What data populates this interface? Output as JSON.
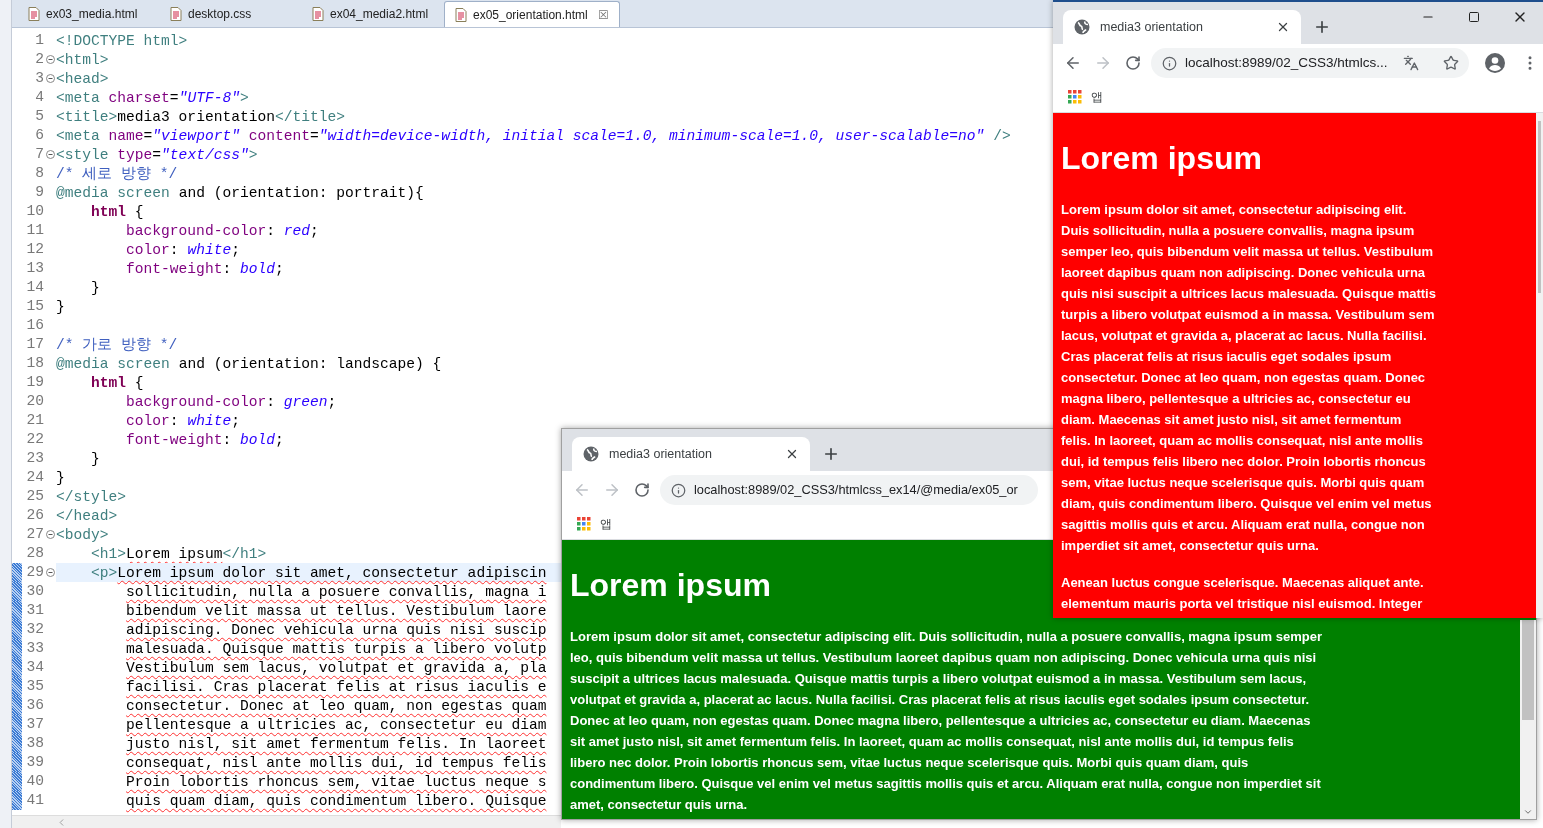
{
  "editor": {
    "tabs": [
      {
        "label": "ex03_media.html",
        "selected": false
      },
      {
        "label": "desktop.css",
        "selected": false
      },
      {
        "label": "ex04_media2.html",
        "selected": false
      },
      {
        "label": "ex05_orientation.html",
        "selected": true,
        "close": "☒"
      }
    ],
    "lines": [
      {
        "number": "1",
        "fold": false,
        "changed": false,
        "current": false,
        "tokens": [
          {
            "kind": "tag",
            "text": "<!DOCTYPE html>"
          }
        ]
      },
      {
        "number": "2",
        "fold": true,
        "changed": false,
        "current": false,
        "tokens": [
          {
            "kind": "tag",
            "text": "<html>"
          }
        ]
      },
      {
        "number": "3",
        "fold": true,
        "changed": false,
        "current": false,
        "tokens": [
          {
            "kind": "tag",
            "text": "<head>"
          }
        ]
      },
      {
        "number": "4",
        "fold": false,
        "changed": false,
        "current": false,
        "tokens": [
          {
            "kind": "tag",
            "text": "<meta "
          },
          {
            "kind": "attr",
            "text": "charset"
          },
          {
            "kind": "text",
            "text": "="
          },
          {
            "kind": "value",
            "text": "\"UTF-8\""
          },
          {
            "kind": "tag",
            "text": ">"
          }
        ]
      },
      {
        "number": "5",
        "fold": false,
        "changed": false,
        "current": false,
        "tokens": [
          {
            "kind": "tag",
            "text": "<title>"
          },
          {
            "kind": "text",
            "text": "media3 orientation"
          },
          {
            "kind": "tag",
            "text": "</title>"
          }
        ]
      },
      {
        "number": "6",
        "fold": false,
        "changed": false,
        "current": false,
        "tokens": [
          {
            "kind": "tag",
            "text": "<meta "
          },
          {
            "kind": "attr",
            "text": "name"
          },
          {
            "kind": "text",
            "text": "="
          },
          {
            "kind": "value",
            "text": "\"viewport\""
          },
          {
            "kind": "attr",
            "text": " content"
          },
          {
            "kind": "text",
            "text": "="
          },
          {
            "kind": "value",
            "text": "\"width=device-width, initial scale=1.0, minimum-scale=1.0, user-scalable=no\""
          },
          {
            "kind": "tag",
            "text": " />"
          }
        ]
      },
      {
        "number": "7",
        "fold": true,
        "changed": false,
        "current": false,
        "tokens": [
          {
            "kind": "tag",
            "text": "<style "
          },
          {
            "kind": "attr",
            "text": "type"
          },
          {
            "kind": "text",
            "text": "="
          },
          {
            "kind": "value",
            "text": "\"text/css\""
          },
          {
            "kind": "tag",
            "text": ">"
          }
        ]
      },
      {
        "number": "8",
        "fold": false,
        "changed": false,
        "current": false,
        "tokens": [
          {
            "kind": "comment",
            "text": "/* 세로 방향 */"
          }
        ]
      },
      {
        "number": "9",
        "fold": false,
        "changed": false,
        "current": false,
        "tokens": [
          {
            "kind": "atrule",
            "text": "@media"
          },
          {
            "kind": "atrule",
            "text": " screen"
          },
          {
            "kind": "text",
            "text": " and (orientation: portrait){"
          }
        ]
      },
      {
        "number": "10",
        "fold": false,
        "changed": false,
        "current": false,
        "tokens": [
          {
            "kind": "selector",
            "text": "    html"
          },
          {
            "kind": "text",
            "text": " {"
          }
        ]
      },
      {
        "number": "11",
        "fold": false,
        "changed": false,
        "current": false,
        "tokens": [
          {
            "kind": "property",
            "text": "        background-color"
          },
          {
            "kind": "text",
            "text": ": "
          },
          {
            "kind": "value",
            "text": "red"
          },
          {
            "kind": "text",
            "text": ";"
          }
        ]
      },
      {
        "number": "12",
        "fold": false,
        "changed": false,
        "current": false,
        "tokens": [
          {
            "kind": "property",
            "text": "        color"
          },
          {
            "kind": "text",
            "text": ": "
          },
          {
            "kind": "value",
            "text": "white"
          },
          {
            "kind": "text",
            "text": ";"
          }
        ]
      },
      {
        "number": "13",
        "fold": false,
        "changed": false,
        "current": false,
        "tokens": [
          {
            "kind": "property",
            "text": "        font-weight"
          },
          {
            "kind": "text",
            "text": ": "
          },
          {
            "kind": "value",
            "text": "bold"
          },
          {
            "kind": "text",
            "text": ";"
          }
        ]
      },
      {
        "number": "14",
        "fold": false,
        "changed": false,
        "current": false,
        "tokens": [
          {
            "kind": "text",
            "text": "    }"
          }
        ]
      },
      {
        "number": "15",
        "fold": false,
        "changed": false,
        "current": false,
        "tokens": [
          {
            "kind": "text",
            "text": "}"
          }
        ]
      },
      {
        "number": "16",
        "fold": false,
        "changed": false,
        "current": false
      },
      {
        "number": "17",
        "fold": false,
        "changed": false,
        "current": false,
        "tokens": [
          {
            "kind": "comment",
            "text": "/* 가로 방향 */"
          }
        ]
      },
      {
        "number": "18",
        "fold": false,
        "changed": false,
        "current": false,
        "tokens": [
          {
            "kind": "atrule",
            "text": "@media"
          },
          {
            "kind": "atrule",
            "text": " screen"
          },
          {
            "kind": "text",
            "text": " and (orientation: landscape) {"
          }
        ]
      },
      {
        "number": "19",
        "fold": false,
        "changed": false,
        "current": false,
        "tokens": [
          {
            "kind": "selector",
            "text": "    html"
          },
          {
            "kind": "text",
            "text": " {"
          }
        ]
      },
      {
        "number": "20",
        "fold": false,
        "changed": false,
        "current": false,
        "tokens": [
          {
            "kind": "property",
            "text": "        background-color"
          },
          {
            "kind": "text",
            "text": ": "
          },
          {
            "kind": "value",
            "text": "green"
          },
          {
            "kind": "text",
            "text": ";"
          }
        ]
      },
      {
        "number": "21",
        "fold": false,
        "changed": false,
        "current": false,
        "tokens": [
          {
            "kind": "property",
            "text": "        color"
          },
          {
            "kind": "text",
            "text": ": "
          },
          {
            "kind": "value",
            "text": "white"
          },
          {
            "kind": "text",
            "text": ";"
          }
        ]
      },
      {
        "number": "22",
        "fold": false,
        "changed": false,
        "current": false,
        "tokens": [
          {
            "kind": "property",
            "text": "        font-weight"
          },
          {
            "kind": "text",
            "text": ": "
          },
          {
            "kind": "value",
            "text": "bold"
          },
          {
            "kind": "text",
            "text": ";"
          }
        ]
      },
      {
        "number": "23",
        "fold": false,
        "changed": false,
        "current": false,
        "tokens": [
          {
            "kind": "text",
            "text": "    }"
          }
        ]
      },
      {
        "number": "24",
        "fold": false,
        "changed": false,
        "current": false,
        "tokens": [
          {
            "kind": "text",
            "text": "}"
          }
        ]
      },
      {
        "number": "25",
        "fold": false,
        "changed": false,
        "current": false,
        "tokens": [
          {
            "kind": "tag",
            "text": "</style>"
          }
        ]
      },
      {
        "number": "26",
        "fold": false,
        "changed": false,
        "current": false,
        "tokens": [
          {
            "kind": "tag",
            "text": "</head>"
          }
        ]
      },
      {
        "number": "27",
        "fold": true,
        "changed": false,
        "current": false,
        "tokens": [
          {
            "kind": "tag",
            "text": "<body>"
          }
        ]
      },
      {
        "number": "28",
        "fold": false,
        "changed": false,
        "current": false,
        "tokens": [
          {
            "kind": "tag",
            "text": "    <h1>"
          },
          {
            "kind": "spell",
            "text": "Lorem ipsum"
          },
          {
            "kind": "tag",
            "text": "</h1>"
          }
        ]
      },
      {
        "number": "29",
        "fold": true,
        "changed": true,
        "current": true,
        "tokens": [
          {
            "kind": "tag",
            "text": "    <p>"
          },
          {
            "kind": "spell",
            "text": "Lorem ipsum dolor sit amet, consectetur adipiscin"
          }
        ]
      },
      {
        "number": "30",
        "fold": false,
        "changed": true,
        "current": false,
        "tokens": [
          {
            "kind": "spell",
            "text": "        sollicitudin, nulla a posuere convallis, magna i"
          }
        ]
      },
      {
        "number": "31",
        "fold": false,
        "changed": true,
        "current": false,
        "tokens": [
          {
            "kind": "spell",
            "text": "        bibendum velit massa ut tellus. Vestibulum laore"
          }
        ]
      },
      {
        "number": "32",
        "fold": false,
        "changed": true,
        "current": false,
        "tokens": [
          {
            "kind": "spell",
            "text": "        adipiscing. Donec vehicula urna quis nisi suscip"
          }
        ]
      },
      {
        "number": "33",
        "fold": false,
        "changed": true,
        "current": false,
        "tokens": [
          {
            "kind": "spell",
            "text": "        malesuada. Quisque mattis turpis a libero volutp"
          }
        ]
      },
      {
        "number": "34",
        "fold": false,
        "changed": true,
        "current": false,
        "tokens": [
          {
            "kind": "spell",
            "text": "        Vestibulum sem lacus, volutpat et gravida a, pla"
          }
        ]
      },
      {
        "number": "35",
        "fold": false,
        "changed": true,
        "current": false,
        "tokens": [
          {
            "kind": "spell",
            "text": "        facilisi. Cras placerat felis at risus iaculis e"
          }
        ]
      },
      {
        "number": "36",
        "fold": false,
        "changed": true,
        "current": false,
        "tokens": [
          {
            "kind": "spell",
            "text": "        consectetur. Donec at leo quam, non egestas quam"
          }
        ]
      },
      {
        "number": "37",
        "fold": false,
        "changed": true,
        "current": false,
        "tokens": [
          {
            "kind": "spell",
            "text": "        pellentesque a ultricies ac, consectetur eu diam"
          }
        ]
      },
      {
        "number": "38",
        "fold": false,
        "changed": true,
        "current": false,
        "tokens": [
          {
            "kind": "spell",
            "text": "        justo nisl, sit amet fermentum felis. In laoreet"
          }
        ]
      },
      {
        "number": "39",
        "fold": false,
        "changed": true,
        "current": false,
        "tokens": [
          {
            "kind": "spell",
            "text": "        consequat, nisl ante mollis dui, id tempus felis"
          }
        ]
      },
      {
        "number": "40",
        "fold": false,
        "changed": true,
        "current": false,
        "tokens": [
          {
            "kind": "spell",
            "text": "        Proin lobortis rhoncus sem, vitae luctus neque s"
          }
        ]
      },
      {
        "number": "41",
        "fold": false,
        "changed": true,
        "current": false,
        "tokens": [
          {
            "kind": "spell",
            "text": "        quis quam diam, quis condimentum libero. Quisque"
          }
        ]
      }
    ]
  },
  "browser_windows": [
    {
      "kind": "landscape",
      "tab_title": "media3 orientation",
      "url": "localhost:8989/02_CSS3/htmlcss_ex14/@media/ex05_or",
      "back_enabled": false,
      "forward_enabled": false,
      "bookmark": "앱",
      "heading": "Lorem ipsum",
      "paragraphs": [
        {
          "lines": [
            "Lorem ipsum dolor sit amet, consectetur adipiscing elit. Duis sollicitudin, nulla a posuere convallis, magna ipsum semper",
            "leo, quis bibendum velit massa ut tellus. Vestibulum laoreet dapibus quam non adipiscing. Donec vehicula urna quis nisi",
            "suscipit a ultrices lacus malesuada. Quisque mattis turpis a libero volutpat euismod a in massa. Vestibulum sem lacus,",
            "volutpat et gravida a, placerat ac lacus. Nulla facilisi. Cras placerat felis at risus iaculis eget sodales ipsum consectetur.",
            "Donec at leo quam, non egestas quam. Donec magna libero, pellentesque a ultricies ac, consectetur eu diam. Maecenas",
            "sit amet justo nisl, sit amet fermentum felis. In laoreet, quam ac mollis consequat, nisl ante mollis dui, id tempus felis",
            "libero nec dolor. Proin lobortis rhoncus sem, vitae luctus neque scelerisque quis. Morbi quis quam diam, quis",
            "condimentum libero. Quisque vel enim vel metus sagittis mollis quis et arcu. Aliquam erat nulla, congue non imperdiet sit",
            "amet, consectetur quis urna."
          ]
        }
      ]
    },
    {
      "kind": "portrait",
      "tab_title": "media3 orientation",
      "url": "localhost:8989/02_CSS3/htmlcs...",
      "back_enabled": true,
      "forward_enabled": false,
      "bookmark": "앱",
      "heading": "Lorem ipsum",
      "paragraphs": [
        {
          "lines": [
            "Lorem ipsum dolor sit amet, consectetur adipiscing elit.",
            "Duis sollicitudin, nulla a posuere convallis, magna ipsum",
            "semper leo, quis bibendum velit massa ut tellus. Vestibulum",
            "laoreet dapibus quam non adipiscing. Donec vehicula urna",
            "quis nisi suscipit a ultrices lacus malesuada. Quisque mattis",
            "turpis a libero volutpat euismod a in massa. Vestibulum sem",
            "lacus, volutpat et gravida a, placerat ac lacus. Nulla facilisi.",
            "Cras placerat felis at risus iaculis eget sodales ipsum",
            "consectetur. Donec at leo quam, non egestas quam. Donec",
            "magna libero, pellentesque a ultricies ac, consectetur eu",
            "diam. Maecenas sit amet justo nisl, sit amet fermentum",
            "felis. In laoreet, quam ac mollis consequat, nisl ante mollis",
            "dui, id tempus felis libero nec dolor. Proin lobortis rhoncus",
            "sem, vitae luctus neque scelerisque quis. Morbi quis quam",
            "diam, quis condimentum libero. Quisque vel enim vel metus",
            "sagittis mollis quis et arcu. Aliquam erat nulla, congue non",
            "imperdiet sit amet, consectetur quis urna."
          ]
        },
        {
          "lines": [
            "Aenean luctus congue scelerisque. Maecenas aliquet ante.",
            "elementum mauris porta vel tristique nisl euismod. Integer"
          ]
        }
      ]
    }
  ]
}
